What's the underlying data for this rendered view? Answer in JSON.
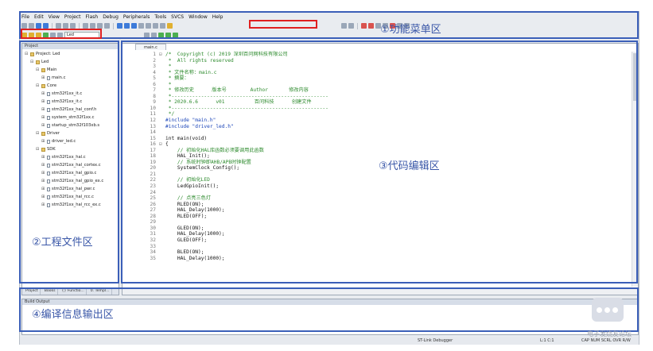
{
  "menu": [
    "File",
    "Edit",
    "View",
    "Project",
    "Flash",
    "Debug",
    "Peripherals",
    "Tools",
    "SVCS",
    "Window",
    "Help"
  ],
  "toolbar": {
    "target_value": "Led"
  },
  "labels": {
    "menu_area": "①功能菜单区",
    "project_area": "②工程文件区",
    "editor_area": "③代码编辑区",
    "output_area": "④编译信息输出区"
  },
  "project_panel": {
    "title": "Project",
    "tree": [
      {
        "label": "Project: Led",
        "type": "root",
        "indent": 0
      },
      {
        "label": "Led",
        "type": "folder",
        "indent": 1
      },
      {
        "label": "Main",
        "type": "folder",
        "indent": 2
      },
      {
        "label": "main.c",
        "type": "file",
        "indent": 3
      },
      {
        "label": "Core",
        "type": "folder",
        "indent": 2
      },
      {
        "label": "stm32f1xx_it.c",
        "type": "file",
        "indent": 3
      },
      {
        "label": "stm32f1xx_it.c",
        "type": "file",
        "indent": 3
      },
      {
        "label": "stm32f1xx_hal_conf.h",
        "type": "file",
        "indent": 3
      },
      {
        "label": "system_stm32f1xx.c",
        "type": "file",
        "indent": 3
      },
      {
        "label": "startup_stm32f103xb.s",
        "type": "file",
        "indent": 3
      },
      {
        "label": "Driver",
        "type": "folder",
        "indent": 2
      },
      {
        "label": "driver_led.c",
        "type": "file",
        "indent": 3
      },
      {
        "label": "SDK",
        "type": "folder",
        "indent": 2
      },
      {
        "label": "stm32f1xx_hal.c",
        "type": "file",
        "indent": 3
      },
      {
        "label": "stm32f1xx_hal_cortex.c",
        "type": "file",
        "indent": 3
      },
      {
        "label": "stm32f1xx_hal_gpio.c",
        "type": "file",
        "indent": 3
      },
      {
        "label": "stm32f1xx_hal_gpio_ex.c",
        "type": "file",
        "indent": 3
      },
      {
        "label": "stm32f1xx_hal_pwr.c",
        "type": "file",
        "indent": 3
      },
      {
        "label": "stm32f1xx_hal_rcc.c",
        "type": "file",
        "indent": 3
      },
      {
        "label": "stm32f1xx_hal_rcc_ex.c",
        "type": "file",
        "indent": 3
      }
    ],
    "tabs": [
      "Project",
      "Books",
      "{} Functio...",
      "0. Templ..."
    ]
  },
  "editor": {
    "tab": "main.c",
    "lines": [
      {
        "n": "1",
        "f": "⊟",
        "t": "/*  Copyright (c) 2019 深圳百问网科技有限公司",
        "k": "c"
      },
      {
        "n": "2",
        "f": "",
        "t": " *  All rights reserved",
        "k": "c"
      },
      {
        "n": "3",
        "f": "",
        "t": " *",
        "k": "c"
      },
      {
        "n": "4",
        "f": "",
        "t": " * 文件名称：main.c",
        "k": "c"
      },
      {
        "n": "5",
        "f": "",
        "t": " * 摘要：",
        "k": "c"
      },
      {
        "n": "6",
        "f": "",
        "t": " *",
        "k": "c"
      },
      {
        "n": "7",
        "f": "",
        "t": " * 修改历史      版本号        Author       修改内容",
        "k": "c"
      },
      {
        "n": "8",
        "f": "",
        "t": " *-----------------------------------------------------",
        "k": "c"
      },
      {
        "n": "9",
        "f": "",
        "t": " * 2020.6.6      v01          百问科技      创建文件",
        "k": "c"
      },
      {
        "n": "10",
        "f": "",
        "t": " *-----------------------------------------------------",
        "k": "c"
      },
      {
        "n": "11",
        "f": "",
        "t": " */",
        "k": "c"
      },
      {
        "n": "12",
        "f": "",
        "t": "#include \"main.h\"",
        "k": "p"
      },
      {
        "n": "13",
        "f": "",
        "t": "#include \"driver_led.h\"",
        "k": "p"
      },
      {
        "n": "14",
        "f": "",
        "t": "",
        "k": "n"
      },
      {
        "n": "15",
        "f": "",
        "t": "int main(void)",
        "k": "n"
      },
      {
        "n": "16",
        "f": "⊟",
        "t": "{",
        "k": "n"
      },
      {
        "n": "17",
        "f": "",
        "t": "    // 初始化HAL库函数必须要调用此函数",
        "k": "c"
      },
      {
        "n": "18",
        "f": "",
        "t": "    HAL_Init();",
        "k": "n"
      },
      {
        "n": "19",
        "f": "",
        "t": "    // 系统时钟即AHB/APB时钟配置",
        "k": "c"
      },
      {
        "n": "20",
        "f": "",
        "t": "    SystemClock_Config();",
        "k": "n"
      },
      {
        "n": "21",
        "f": "",
        "t": "",
        "k": "n"
      },
      {
        "n": "22",
        "f": "",
        "t": "    // 初始化LED",
        "k": "c"
      },
      {
        "n": "23",
        "f": "",
        "t": "    LedGpioInit();",
        "k": "n"
      },
      {
        "n": "24",
        "f": "",
        "t": "",
        "k": "n"
      },
      {
        "n": "25",
        "f": "",
        "t": "    // 点亮三色灯",
        "k": "c"
      },
      {
        "n": "26",
        "f": "",
        "t": "    RLED(ON);",
        "k": "n"
      },
      {
        "n": "27",
        "f": "",
        "t": "    HAL_Delay(1000);",
        "k": "n"
      },
      {
        "n": "28",
        "f": "",
        "t": "    RLED(OFF);",
        "k": "n"
      },
      {
        "n": "29",
        "f": "",
        "t": "",
        "k": "n"
      },
      {
        "n": "30",
        "f": "",
        "t": "    GLED(ON);",
        "k": "n"
      },
      {
        "n": "31",
        "f": "",
        "t": "    HAL_Delay(1000);",
        "k": "n"
      },
      {
        "n": "32",
        "f": "",
        "t": "    GLED(OFF);",
        "k": "n"
      },
      {
        "n": "33",
        "f": "",
        "t": "",
        "k": "n"
      },
      {
        "n": "34",
        "f": "",
        "t": "    BLED(ON);",
        "k": "n"
      },
      {
        "n": "35",
        "f": "",
        "t": "    HAL_Delay(1000);",
        "k": "n"
      }
    ]
  },
  "build_output": {
    "title": "Build Output"
  },
  "status": {
    "debugger": "ST-Link Debugger",
    "position": "L:1 C:1",
    "caps": "CAP  NUM  SCRL  OVR  R/W"
  },
  "watermark": "电子发烧友论坛",
  "colors": {
    "frame_blue": "#3b5fb8",
    "frame_red": "#e02020",
    "comment_green": "#2e8b2e",
    "keyword_blue": "#1a44b8"
  }
}
